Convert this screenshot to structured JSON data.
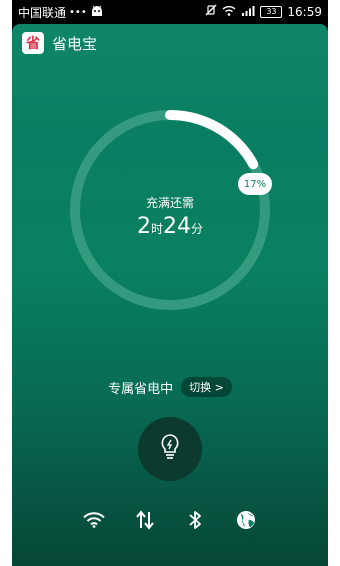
{
  "status_bar": {
    "carrier": "中国联通",
    "dots": "•••",
    "battery_level": "33",
    "time": "16:59"
  },
  "app": {
    "title": "省电宝",
    "logo_char": "省"
  },
  "charge": {
    "heading": "充满还需",
    "hours_value": "2",
    "hours_unit": "时",
    "minutes_value": "24",
    "minutes_unit": "分",
    "percent_label": "17%",
    "progress": 0.17
  },
  "mode": {
    "label": "专属省电中",
    "switch_label": "切换 >"
  },
  "toggles": [
    {
      "name": "wifi-icon"
    },
    {
      "name": "data-transfer-icon"
    },
    {
      "name": "bluetooth-icon"
    },
    {
      "name": "globe-icon"
    }
  ],
  "colors": {
    "accent": "#0a7e62",
    "ring_track": "#3a9d83",
    "ring_fill": "#ffffff"
  }
}
